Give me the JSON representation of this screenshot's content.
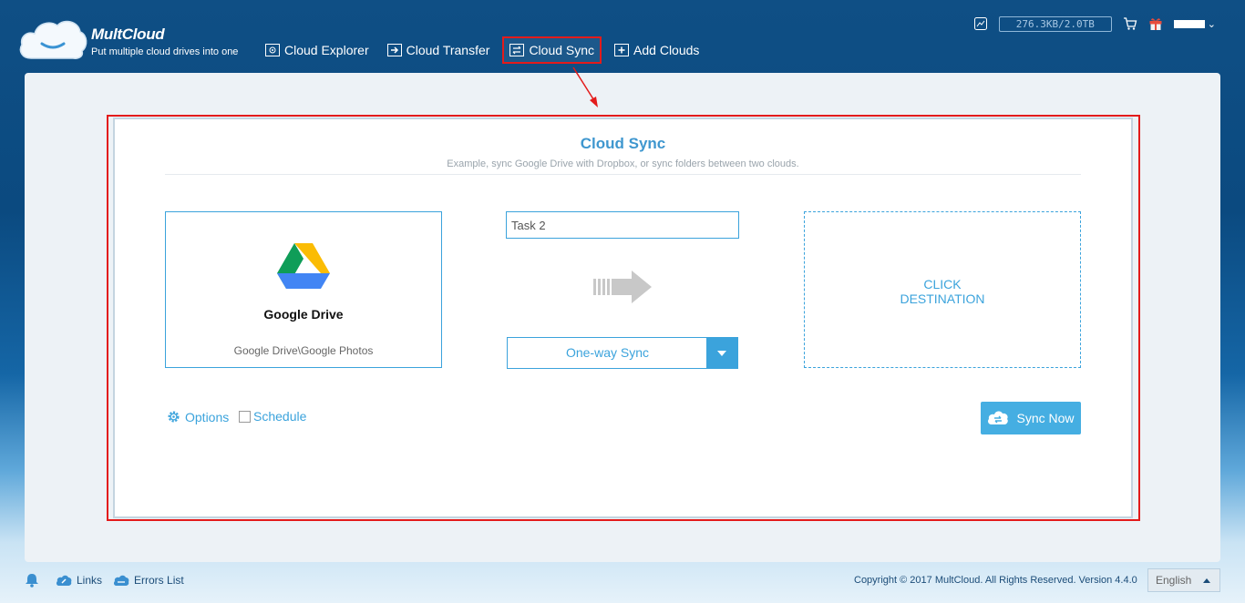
{
  "header": {
    "logo_name": "MultCloud",
    "logo_tagline": "Put multiple cloud drives into one",
    "nav": [
      {
        "label": "Cloud Explorer",
        "icon": "explorer-icon"
      },
      {
        "label": "Cloud Transfer",
        "icon": "transfer-icon"
      },
      {
        "label": "Cloud Sync",
        "icon": "sync-icon",
        "active": true
      },
      {
        "label": "Add Clouds",
        "icon": "add-icon"
      }
    ],
    "traffic": "276.3KB/2.0TB"
  },
  "sync_card": {
    "title": "Cloud Sync",
    "subtitle": "Example, sync Google Drive with Dropbox, or sync folders between two clouds.",
    "source": {
      "name": "Google Drive",
      "path": "Google Drive\\Google Photos"
    },
    "task_name": "Task 2",
    "sync_mode": "One-way Sync",
    "destination_line1": "CLICK",
    "destination_line2": "DESTINATION",
    "options_label": "Options",
    "schedule_label": "Schedule",
    "sync_now_label": "Sync Now"
  },
  "footer": {
    "links_label": "Links",
    "errors_label": "Errors List",
    "copyright": "Copyright © 2017 MultCloud. All Rights Reserved. Version 4.4.0",
    "language": "English"
  },
  "colors": {
    "accent": "#3ba3dc",
    "highlight": "#e31b1b",
    "header_bg": "#0b4a80"
  }
}
